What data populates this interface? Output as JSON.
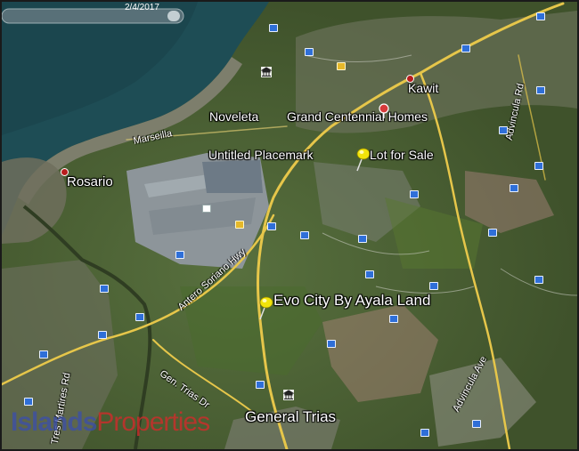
{
  "imagery_date": "2/4/2017",
  "placemarks": {
    "lot_for_sale": "Lot for Sale",
    "evo_city": "Evo City By Ayala Land",
    "untitled": "Untitled Placemark",
    "grand_centennial": "Grand Centennial Homes"
  },
  "places": {
    "kawit": "Kawit",
    "noveleta": "Noveleta",
    "rosario": "Rosario",
    "general_trias": "General Trias"
  },
  "roads": {
    "marseilla": "Marseilla",
    "antero_soriano": "Antero Soriano Hwy",
    "gen_trias_dr": "Gen. Trias Dr",
    "advincula_ave": "Advincula Ave",
    "advincula_rd": "Advincula Rd",
    "tres_martires": "Tres Martires Rd"
  },
  "watermark": {
    "part1": "Islands",
    "part2": "Properties"
  },
  "colors": {
    "water": "#1d4a50",
    "land": "#4c5f36",
    "road": "#e6c64a",
    "pin": "#f1e40b"
  }
}
